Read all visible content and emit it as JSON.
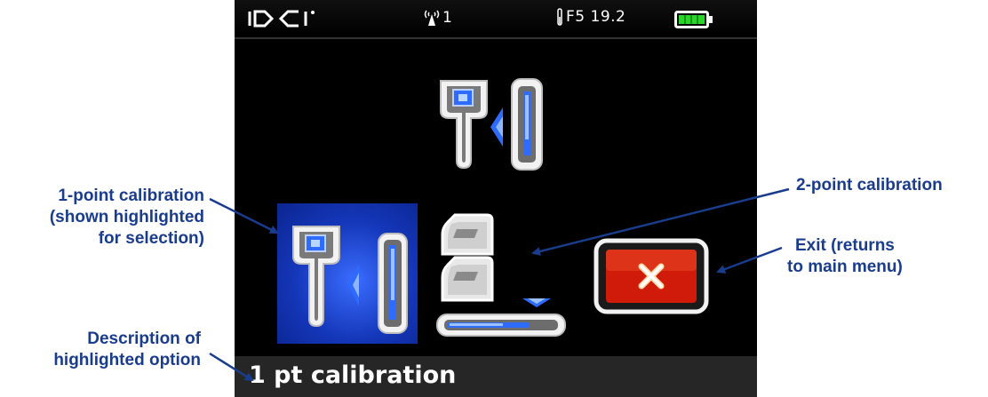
{
  "status_bar": {
    "logo": "DCI",
    "signal_icon": "antenna-signal-icon",
    "channel": "1",
    "frequency_readout": "F5 19.2",
    "battery_icon": "battery-full-icon"
  },
  "options": [
    {
      "id": "top",
      "icon": "locator-transmitter-icon"
    },
    {
      "id": "one-point",
      "icon": "locator-transmitter-icon",
      "highlighted": true
    },
    {
      "id": "two-point",
      "icon": "two-point-calibration-icon"
    },
    {
      "id": "exit",
      "icon": "close-icon"
    }
  ],
  "description": "1 pt calibration",
  "callouts": {
    "one_point": [
      "1-point calibration",
      "(shown highlighted",
      "for selection)"
    ],
    "two_point": [
      "2-point calibration"
    ],
    "exit": [
      "Exit (returns",
      "to main menu)"
    ],
    "description": [
      "Description of",
      "highlighted option"
    ]
  },
  "colors": {
    "callout_text": "#1a3c8c",
    "highlight": "#1436b8",
    "exit_red": "#d01a0a",
    "screen_bg": "#000000"
  }
}
